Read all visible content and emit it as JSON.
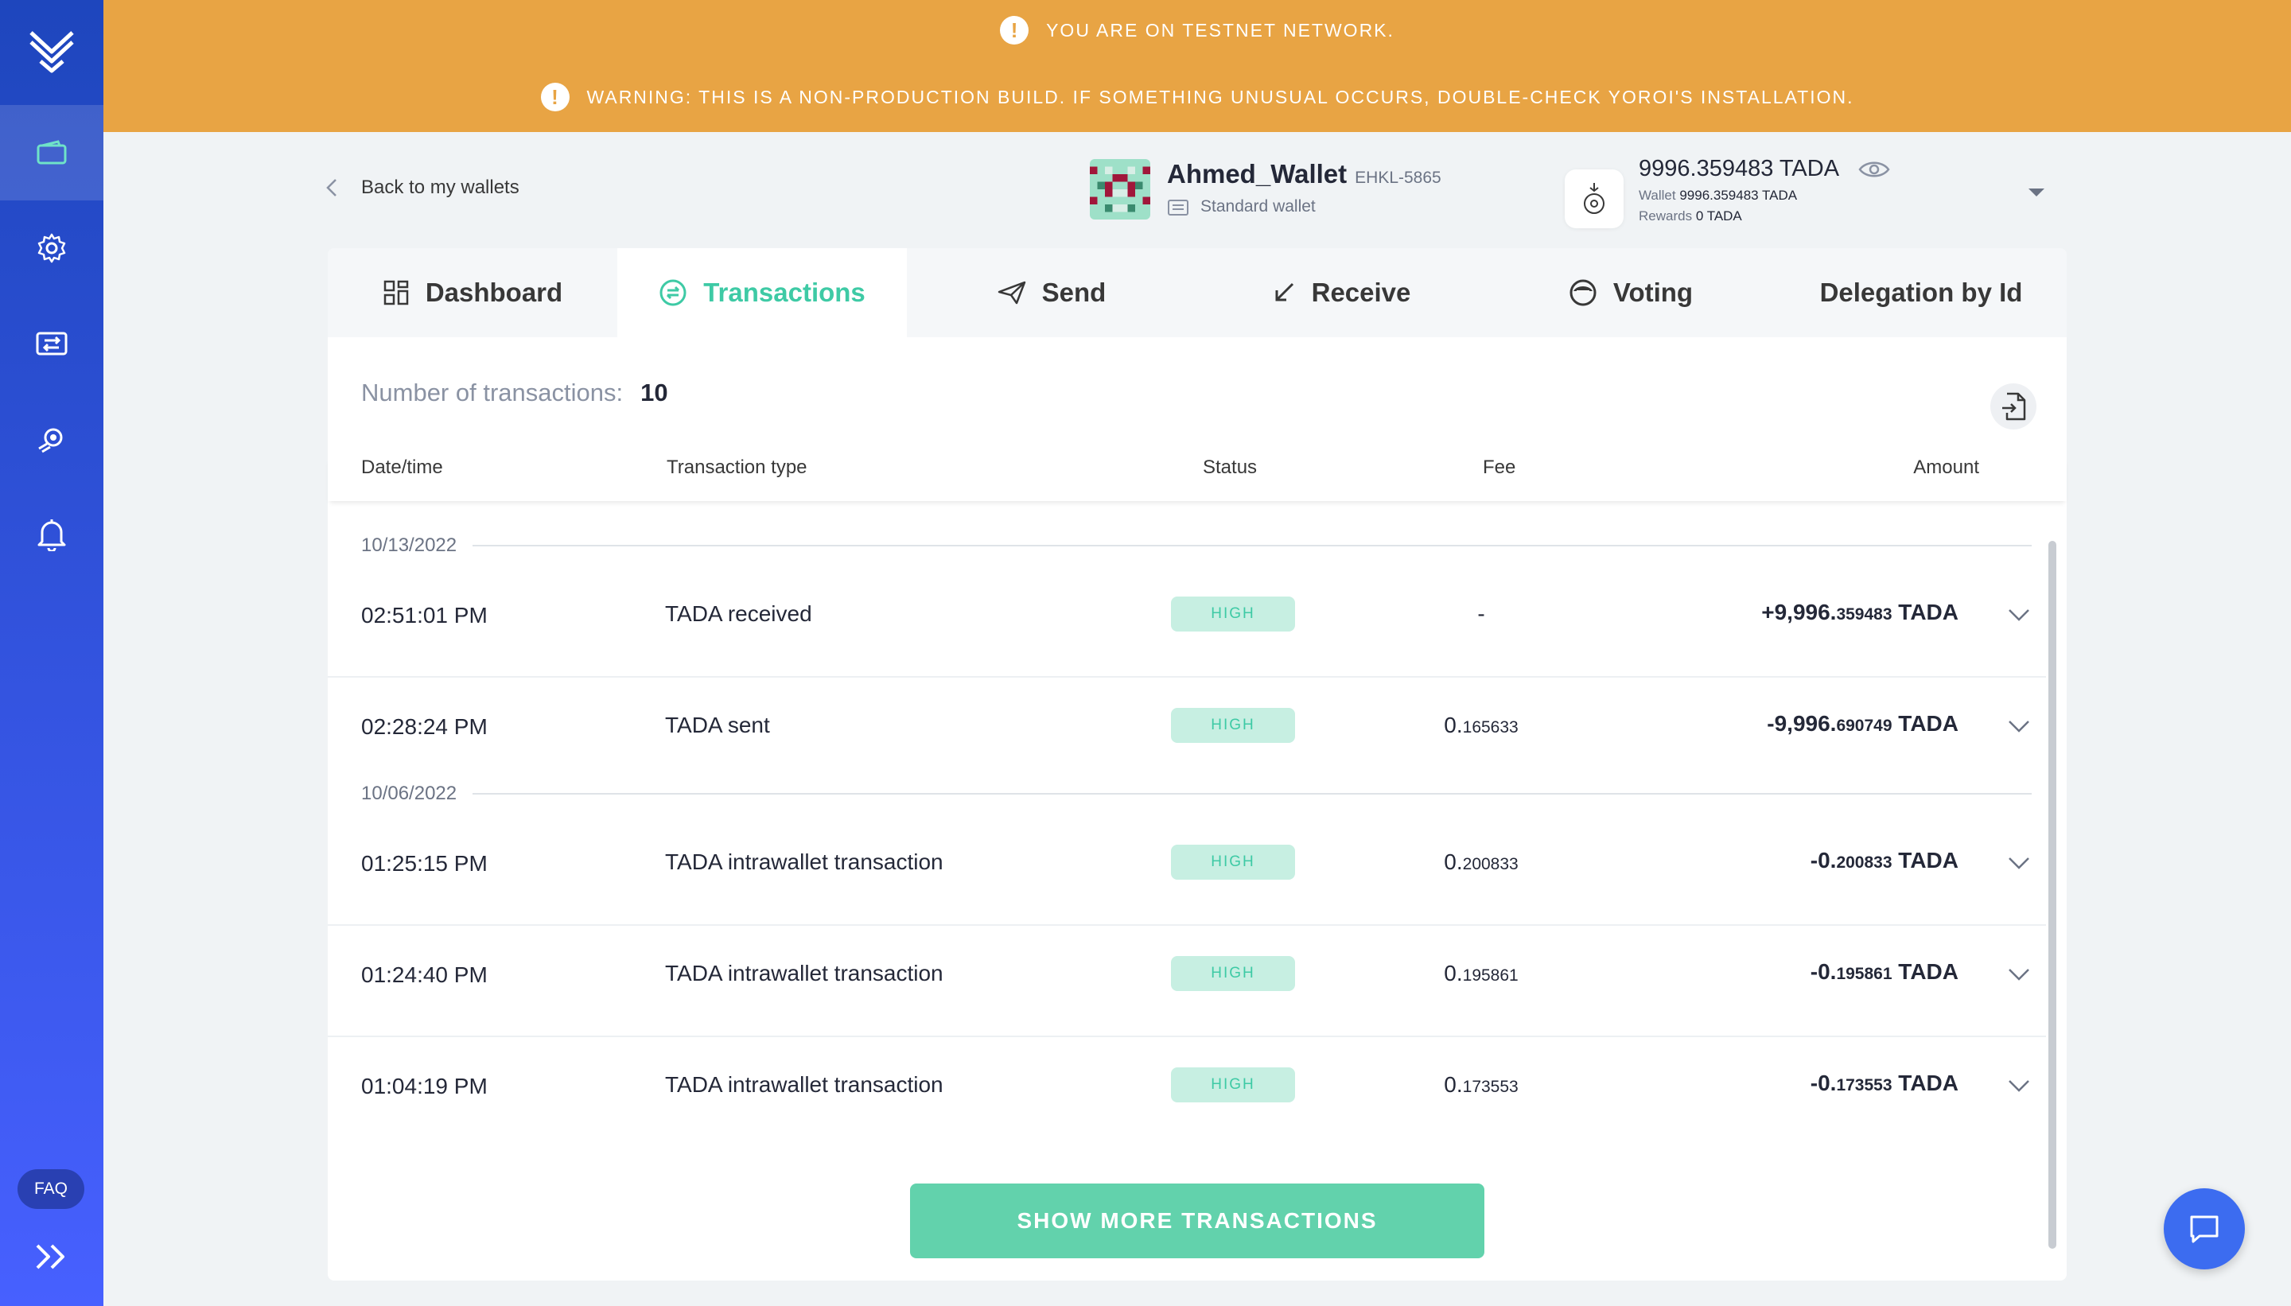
{
  "banner": {
    "testnet": "YOU ARE ON TESTNET NETWORK.",
    "warning": "WARNING: THIS IS A NON-PRODUCTION BUILD. IF SOMETHING UNUSUAL OCCURS, DOUBLE-CHECK YOROI'S INSTALLATION.",
    "color": "#e8a444"
  },
  "sidebar": {
    "items": [
      {
        "icon": "wallet-icon",
        "active": true
      },
      {
        "icon": "gear-icon",
        "active": false
      },
      {
        "icon": "transfer-icon",
        "active": false
      },
      {
        "icon": "staking-icon",
        "active": false
      },
      {
        "icon": "bell-icon",
        "active": false
      }
    ],
    "faq_label": "FAQ"
  },
  "header": {
    "back_label": "Back to my wallets",
    "wallet_name": "Ahmed_Wallet",
    "wallet_plate": "EHKL-5865",
    "wallet_type": "Standard wallet",
    "balance": "9996.359483 TADA",
    "wallet_label": "Wallet",
    "wallet_balance": "9996.359483 TADA",
    "rewards_label": "Rewards",
    "rewards_balance": "0 TADA"
  },
  "tabs": [
    {
      "label": "Dashboard",
      "icon": "dashboard-icon",
      "active": false
    },
    {
      "label": "Transactions",
      "icon": "transactions-icon",
      "active": true
    },
    {
      "label": "Send",
      "icon": "send-icon",
      "active": false
    },
    {
      "label": "Receive",
      "icon": "receive-icon",
      "active": false
    },
    {
      "label": "Voting",
      "icon": "voting-icon",
      "active": false
    },
    {
      "label": "Delegation by Id",
      "icon": "",
      "active": false
    }
  ],
  "transactions": {
    "count_label": "Number of transactions:",
    "count": "10",
    "columns": [
      "Date/time",
      "Transaction type",
      "Status",
      "Fee",
      "Amount"
    ],
    "groups": [
      {
        "date": "10/13/2022",
        "rows": [
          {
            "time": "02:51:01 PM",
            "type": "TADA received",
            "status": "HIGH",
            "fee_main": "-",
            "fee_small": "",
            "amt_main": "+9,996.",
            "amt_small": "359483",
            "amt_unit": " TADA"
          },
          {
            "time": "02:28:24 PM",
            "type": "TADA sent",
            "status": "HIGH",
            "fee_main": "0.",
            "fee_small": "165633",
            "amt_main": "-9,996.",
            "amt_small": "690749",
            "amt_unit": " TADA"
          }
        ]
      },
      {
        "date": "10/06/2022",
        "rows": [
          {
            "time": "01:25:15 PM",
            "type": "TADA intrawallet transaction",
            "status": "HIGH",
            "fee_main": "0.",
            "fee_small": "200833",
            "amt_main": "-0.",
            "amt_small": "200833",
            "amt_unit": " TADA"
          },
          {
            "time": "01:24:40 PM",
            "type": "TADA intrawallet transaction",
            "status": "HIGH",
            "fee_main": "0.",
            "fee_small": "195861",
            "amt_main": "-0.",
            "amt_small": "195861",
            "amt_unit": " TADA"
          },
          {
            "time": "01:04:19 PM",
            "type": "TADA intrawallet transaction",
            "status": "HIGH",
            "fee_main": "0.",
            "fee_small": "173553",
            "amt_main": "-0.",
            "amt_small": "173553",
            "amt_unit": " TADA"
          }
        ]
      }
    ],
    "show_more_label": "SHOW MORE TRANSACTIONS"
  },
  "colors": {
    "accent": "#3ecaa5",
    "sidebar_top": "#1e46bd",
    "sidebar_bottom": "#4760ff",
    "chat": "#3c6cf0"
  }
}
